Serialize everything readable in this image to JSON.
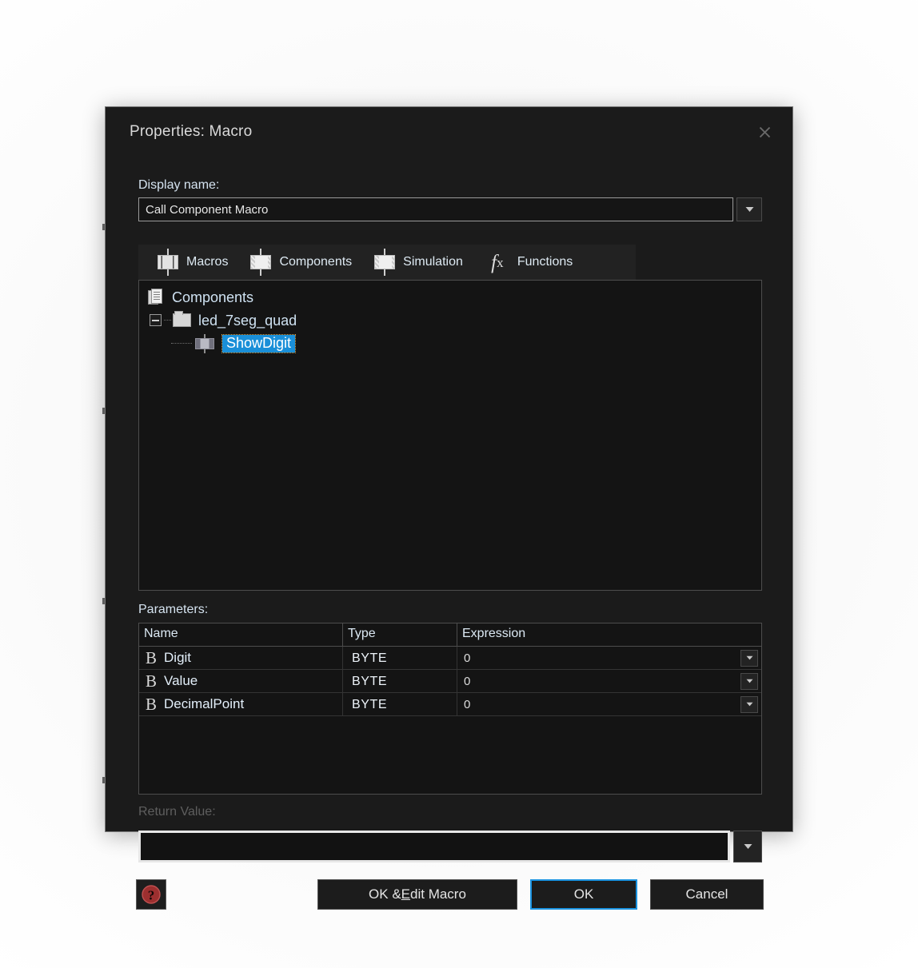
{
  "dialog": {
    "title": "Properties: Macro",
    "close_icon": "close-icon"
  },
  "display_name": {
    "label": "Display name:",
    "value": "Call Component Macro",
    "placeholder": "",
    "dropdown_icon": "chevron-down-icon"
  },
  "tabs": [
    {
      "label": "Macros",
      "icon": "chip-icon"
    },
    {
      "label": "Components",
      "icon": "component-chip-icon"
    },
    {
      "label": "Simulation",
      "icon": "simulation-chip-icon"
    },
    {
      "label": "Functions",
      "icon": "fx-icon"
    }
  ],
  "tree": {
    "root": {
      "label": "Components",
      "icon": "documents-icon"
    },
    "folder": {
      "label": "led_7seg_quad",
      "icon": "folder-icon",
      "expander": "minus-box-icon",
      "expanded": true
    },
    "leaf": {
      "label": "ShowDigit",
      "icon": "macro-icon",
      "selected": true
    }
  },
  "parameters": {
    "label": "Parameters:",
    "columns": [
      "Name",
      "Type",
      "Expression"
    ],
    "rows": [
      {
        "icon": "byte-type-icon",
        "name": "Digit",
        "type": "BYTE",
        "expression": "0",
        "dropdown_icon": "chevron-down-icon"
      },
      {
        "icon": "byte-type-icon",
        "name": "Value",
        "type": "BYTE",
        "expression": "0",
        "dropdown_icon": "chevron-down-icon"
      },
      {
        "icon": "byte-type-icon",
        "name": "DecimalPoint",
        "type": "BYTE",
        "expression": "0",
        "dropdown_icon": "chevron-down-icon"
      }
    ]
  },
  "return_value": {
    "label": "Return Value:",
    "value": "",
    "placeholder": "",
    "disabled": true,
    "dropdown_icon": "chevron-down-icon"
  },
  "footer": {
    "help_icon": "help-icon",
    "ok_edit_macro": {
      "prefix": "OK & ",
      "accel": "E",
      "suffix": "dit Macro"
    },
    "ok": "OK",
    "cancel": "Cancel"
  },
  "colors": {
    "dialog_bg": "#1b1b1b",
    "panel_bg": "#141414",
    "selection_blue": "#1a8fd8",
    "focus_blue": "#1b93e0",
    "text": "#dce9f4",
    "disabled_text": "#5e5e5e",
    "help_red": "#9d2f2f"
  }
}
